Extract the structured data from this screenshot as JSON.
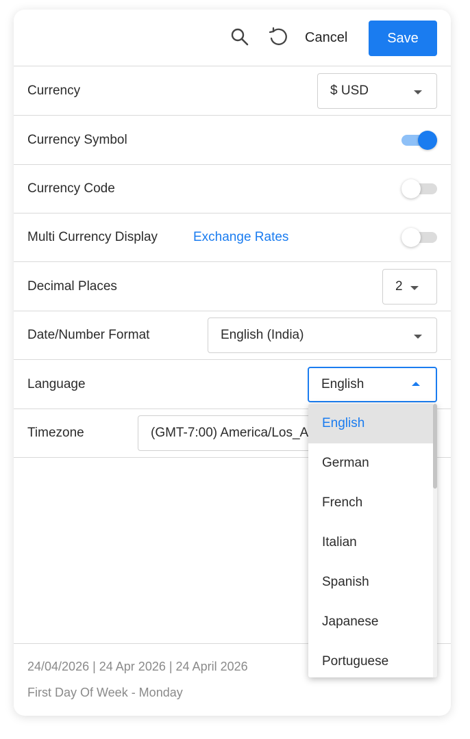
{
  "toolbar": {
    "search_icon": "search-icon",
    "reset_icon": "reset-icon",
    "cancel_label": "Cancel",
    "save_label": "Save"
  },
  "settings": {
    "currency": {
      "label": "Currency",
      "value": "$ USD"
    },
    "currency_symbol": {
      "label": "Currency Symbol",
      "enabled": true
    },
    "currency_code": {
      "label": "Currency Code",
      "enabled": false
    },
    "multi_currency": {
      "label": "Multi Currency Display",
      "link": "Exchange Rates",
      "enabled": false
    },
    "decimal_places": {
      "label": "Decimal Places",
      "value": "2"
    },
    "date_number_format": {
      "label": "Date/Number Format",
      "value": "English (India)"
    },
    "language": {
      "label": "Language",
      "value": "English"
    },
    "timezone": {
      "label": "Timezone",
      "value": "(GMT-7:00) America/Los_Angeles"
    }
  },
  "language_dropdown": {
    "options": [
      "English",
      "German",
      "French",
      "Italian",
      "Spanish",
      "Japanese",
      "Portuguese"
    ],
    "selected": "English"
  },
  "footer": {
    "date_formats": "24/04/2026  | 24 Apr 2026  | 24 April 2026",
    "first_day": "First Day Of Week - Monday"
  },
  "colors": {
    "accent": "#1a7cf0",
    "border": "#d9d9d9",
    "muted_text": "#8a8a8a"
  }
}
